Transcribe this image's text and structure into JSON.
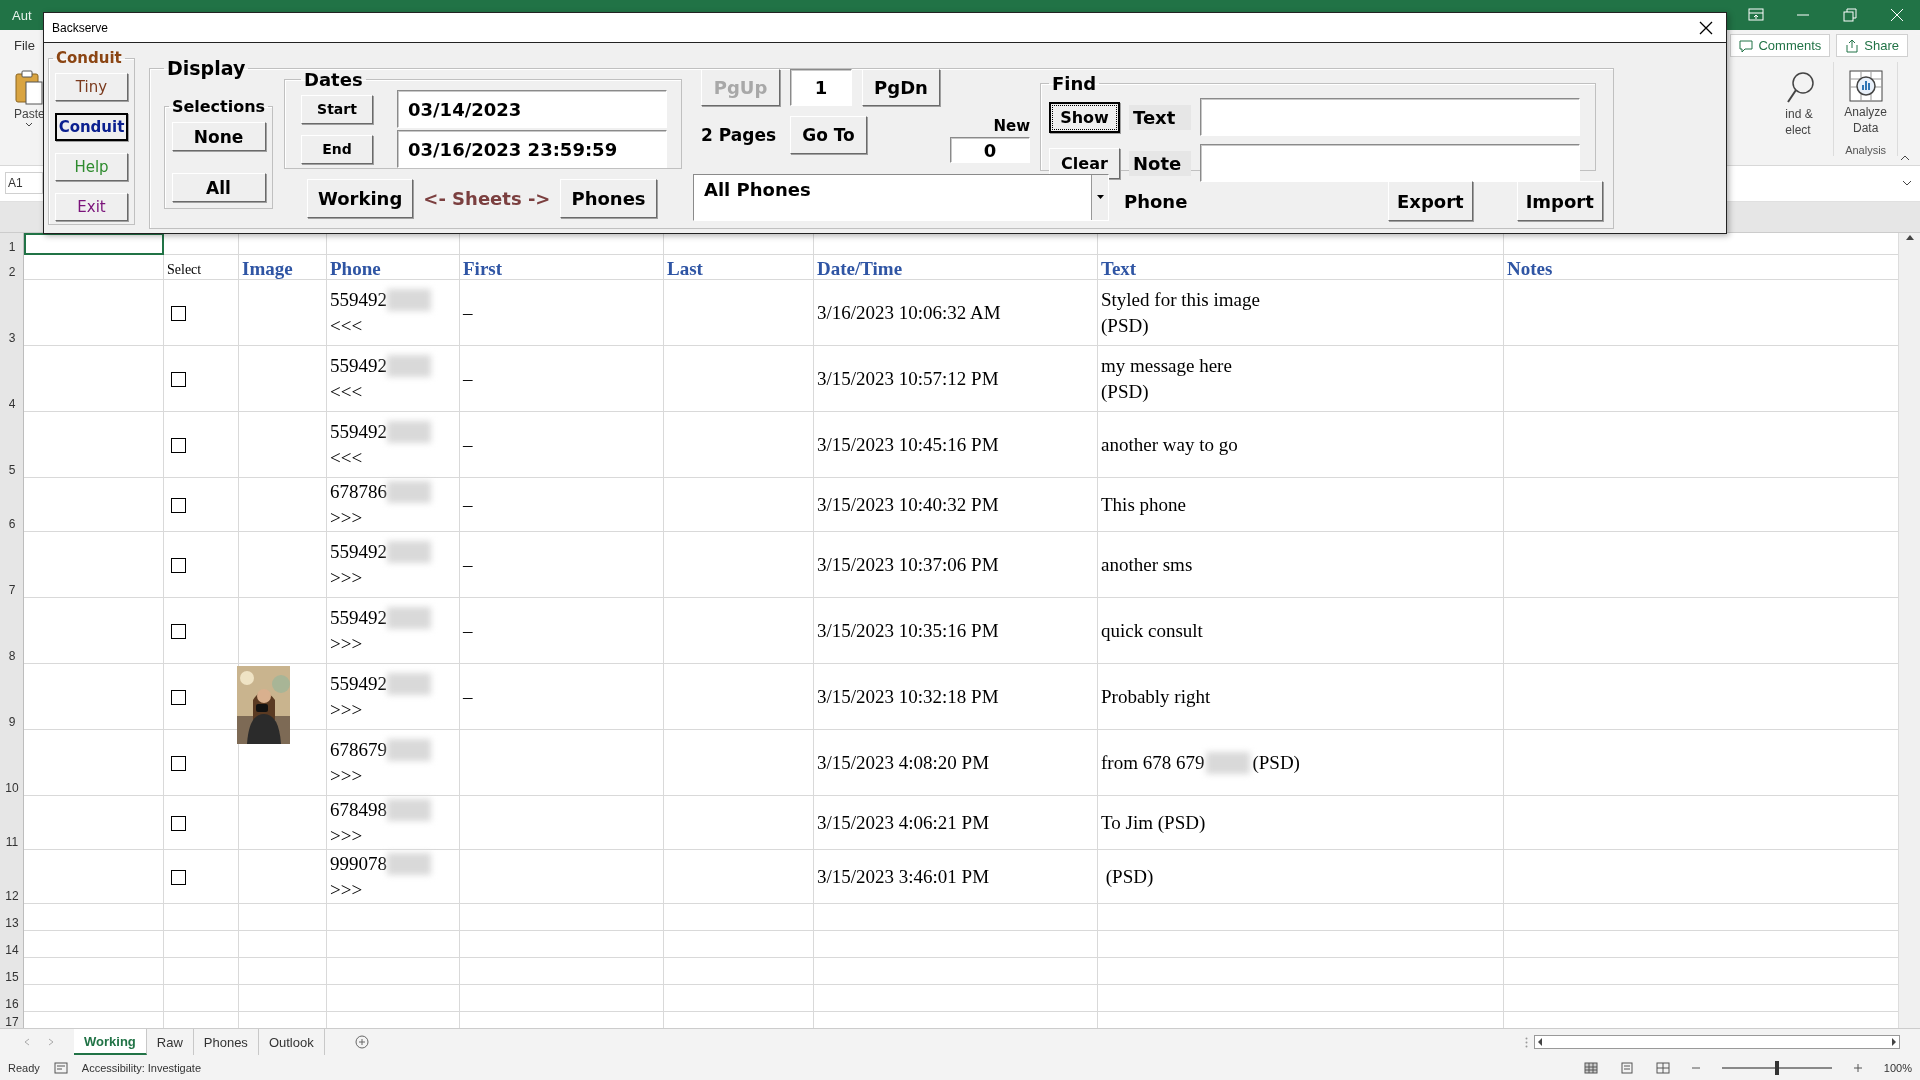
{
  "excel": {
    "title": "Aut",
    "menu": "File",
    "paste": "Paste",
    "name_box": "A1",
    "comments": "Comments",
    "share": "Share",
    "find_lines": [
      "ind &",
      "elect"
    ],
    "analyze_lines": [
      "Analyze",
      "Data"
    ],
    "group": "Analysis"
  },
  "dialog": {
    "title": "Backserve",
    "conduit": {
      "title": "Conduit",
      "buttons": [
        {
          "label": "Tiny",
          "color": "#7b3a1e",
          "selected": false
        },
        {
          "label": "Conduit",
          "color": "#0a1f8f",
          "selected": true
        },
        {
          "label": "Help",
          "color": "#2e8b2e",
          "selected": false
        },
        {
          "label": "Exit",
          "color": "#7a137a",
          "selected": false
        }
      ]
    },
    "display": {
      "title": "Display",
      "selections": {
        "title": "Selections",
        "buttons": [
          "None",
          "All"
        ]
      },
      "dates": {
        "title": "Dates",
        "start_button": "Start",
        "end_button": "End",
        "start": "03/14/2023",
        "end": "03/16/2023 23:59:59"
      },
      "sheets": {
        "left_button": "Working",
        "label": "<- Sheets ->",
        "right_button": "Phones"
      },
      "paging": {
        "prev": {
          "label": "PgUp",
          "disabled": true
        },
        "page": "1",
        "next": {
          "label": "PgDn",
          "disabled": false
        },
        "pages": "2 Pages",
        "goto": "Go To"
      },
      "new": {
        "label": "New",
        "value": "0"
      },
      "find": {
        "title": "Find",
        "show": {
          "label": "Show",
          "focused": true
        },
        "clear": {
          "label": "Clear",
          "focused": false
        },
        "fields": [
          {
            "label": "Text"
          },
          {
            "label": "Note"
          }
        ]
      },
      "phone_filter": {
        "value": "All Phones"
      },
      "phone_label": "Phone",
      "export": "Export",
      "import": "Import"
    }
  },
  "sheet": {
    "row_numbers": [
      "1",
      "2",
      "3",
      "4",
      "5",
      "6",
      "7",
      "8",
      "9",
      "10",
      "11",
      "12",
      "13",
      "14",
      "15",
      "16",
      "17"
    ],
    "select_heading": "Select",
    "columns": [
      "Image",
      "Phone",
      "First",
      "Last",
      "Date/Time",
      "Text",
      "Notes"
    ],
    "rows": [
      {
        "checked": false,
        "phone": "559492",
        "direction": "<<<",
        "first": "–",
        "datetime": "3/16/2023 10:06:32 AM",
        "text_lines": [
          "Styled for this image",
          "(PSD)"
        ]
      },
      {
        "checked": false,
        "phone": "559492",
        "direction": "<<<",
        "first": "–",
        "datetime": "3/15/2023 10:57:12 PM",
        "text_lines": [
          "my message here",
          "(PSD)"
        ]
      },
      {
        "checked": false,
        "phone": "559492",
        "direction": "<<<",
        "first": "–",
        "datetime": "3/15/2023 10:45:16 PM",
        "text_lines": [
          "another way to go"
        ]
      },
      {
        "checked": false,
        "phone": "678786",
        "direction": ">>>",
        "first": "–",
        "datetime": "3/15/2023 10:40:32 PM",
        "text_lines": [
          "This phone"
        ]
      },
      {
        "checked": false,
        "phone": "559492",
        "direction": ">>>",
        "first": "–",
        "datetime": "3/15/2023 10:37:06 PM",
        "text_lines": [
          "another sms"
        ]
      },
      {
        "checked": false,
        "phone": "559492",
        "direction": ">>>",
        "first": "–",
        "datetime": "3/15/2023 10:35:16 PM",
        "text_lines": [
          "quick consult"
        ]
      },
      {
        "checked": false,
        "image": {
          "kind": "picture"
        },
        "phone": "559492",
        "direction": ">>>",
        "first": "–",
        "datetime": "3/15/2023 10:32:18 PM",
        "text_lines": [
          "Probably right"
        ]
      },
      {
        "checked": false,
        "phone": "678679",
        "direction": ">>>",
        "datetime": "3/15/2023 4:08:20 PM",
        "text_lines": [
          "from 678 679"
        ],
        "text_suffix": "(PSD)"
      },
      {
        "checked": false,
        "phone": "678498",
        "direction": ">>>",
        "datetime": "3/15/2023 4:06:21 PM",
        "text_lines": [
          "To Jim (PSD)"
        ]
      },
      {
        "checked": false,
        "phone": "999078",
        "direction": ">>>",
        "datetime": "3/15/2023 3:46:01 PM",
        "text_lines": [
          " (PSD)"
        ]
      }
    ]
  },
  "sheet_tabs": [
    {
      "label": "Working",
      "selected": true
    },
    {
      "label": "Raw",
      "selected": false
    },
    {
      "label": "Phones",
      "selected": false
    },
    {
      "label": "Outlook",
      "selected": false
    }
  ],
  "status_bar": {
    "ready": "Ready",
    "accessibility": "Accessibility: Investigate",
    "zoom": "100%",
    "zoom_level": {
      "level": 0.5
    }
  }
}
